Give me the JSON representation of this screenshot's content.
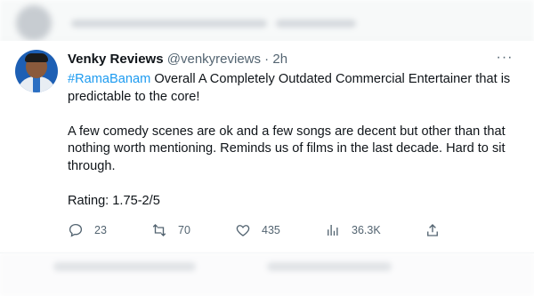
{
  "tweet": {
    "author_name": "Venky Reviews",
    "author_handle": "@venkyreviews",
    "separator": " · ",
    "time": "2h",
    "hashtag": "#RamaBanam",
    "line1_rest": " Overall A Completely Outdated Commercial Entertainer that is predictable to the core!",
    "paragraph2": "A few comedy scenes are ok and a few songs are decent but other than that nothing worth mentioning. Reminds us of films in the last decade. Hard to sit through.",
    "rating": "Rating: 1.75-2/5",
    "more_icon": "···"
  },
  "actions": {
    "reply": {
      "icon": "reply-icon",
      "count": "23"
    },
    "retweet": {
      "icon": "retweet-icon",
      "count": "70"
    },
    "like": {
      "icon": "like-icon",
      "count": "435"
    },
    "views": {
      "icon": "views-icon",
      "count": "36.3K"
    },
    "share": {
      "icon": "share-icon"
    }
  },
  "colors": {
    "accent": "#1d9bf0",
    "text": "#0f1419",
    "muted": "#536471"
  }
}
